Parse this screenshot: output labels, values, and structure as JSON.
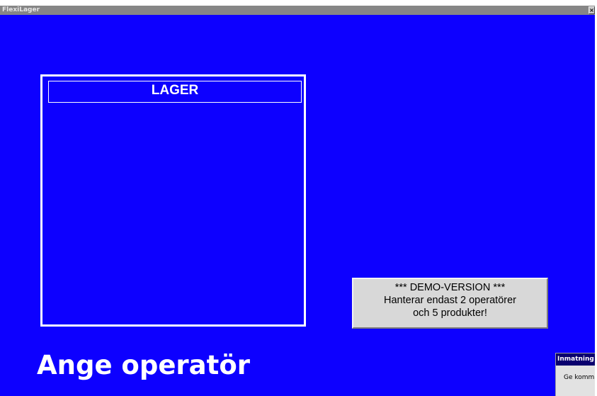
{
  "window": {
    "title": "FlexiLager",
    "close_icon": "close-x-icon",
    "background_color": "#0d00ff"
  },
  "lager_panel": {
    "title": "LAGER"
  },
  "demo_notice": {
    "line1": "*** DEMO-VERSION ***",
    "line2": "Hanterar endast 2 operatörer",
    "line3": "och 5 produkter!"
  },
  "prompt": {
    "text": "Ange operatör"
  },
  "dialog": {
    "title": "Inmatning",
    "message": "Ge komm"
  }
}
